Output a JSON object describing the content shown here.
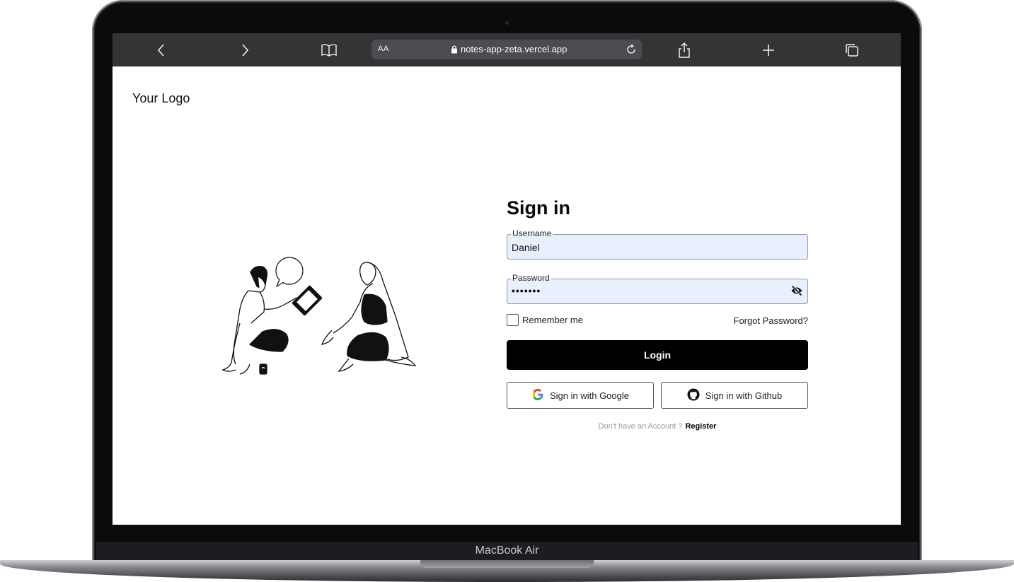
{
  "device": {
    "label": "MacBook Air"
  },
  "browser": {
    "text_size_label": "AA",
    "url": "notes-app-zeta.vercel.app",
    "icons": [
      "chevron-left-icon",
      "chevron-right-icon",
      "book-icon",
      "lock-icon",
      "reload-icon",
      "share-icon",
      "plus-icon",
      "tabs-icon"
    ]
  },
  "page": {
    "logo": "Your Logo",
    "form": {
      "title": "Sign in",
      "username_label": "Username",
      "username_value": "Daniel",
      "password_label": "Password",
      "password_value": "•••••••",
      "remember_label": "Remember me",
      "remember_checked": false,
      "forgot_label": "Forgot Password?",
      "login_label": "Login",
      "google_label": "Sign in with Google",
      "github_label": "Sign in with Github",
      "no_account_text": "Don't have an Account ?",
      "register_label": "Register"
    }
  },
  "colors": {
    "browser_bar": "#333436",
    "input_fill": "#e8f0fe",
    "primary_button": "#000000"
  }
}
